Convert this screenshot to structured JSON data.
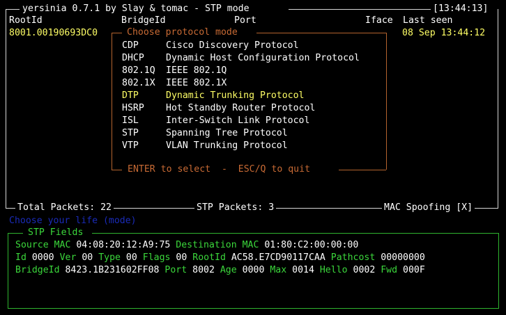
{
  "window": {
    "title": "yersinia 0.7.1 by Slay & tomac - STP mode",
    "clock": "[13:44:13]"
  },
  "table": {
    "headers": {
      "root_id": "RootId",
      "bridge_id": "BridgeId",
      "port": "Port",
      "iface": "Iface",
      "last_seen": "Last seen"
    },
    "rows": [
      {
        "root_id": "8001.00190693DC0",
        "last_seen": "08 Sep 13:44:12"
      }
    ]
  },
  "dialog": {
    "title": "Choose protocol mode",
    "items": [
      {
        "code": "CDP",
        "name": "Cisco Discovery Protocol"
      },
      {
        "code": "DHCP",
        "name": "Dynamic Host Configuration Protocol"
      },
      {
        "code": "802.1Q",
        "name": "IEEE 802.1Q"
      },
      {
        "code": "802.1X",
        "name": "IEEE 802.1X"
      },
      {
        "code": "DTP",
        "name": "Dynamic Trunking Protocol"
      },
      {
        "code": "HSRP",
        "name": "Hot Standby Router Protocol"
      },
      {
        "code": "ISL",
        "name": "Inter-Switch Link Protocol"
      },
      {
        "code": "STP",
        "name": "Spanning Tree Protocol"
      },
      {
        "code": "VTP",
        "name": "VLAN Trunking Protocol"
      }
    ],
    "selected_index": 4,
    "footer": "ENTER to select  -  ESC/Q to quit"
  },
  "status": {
    "total_packets": "Total Packets: 22",
    "stp_packets": "STP Packets: 3",
    "mac_spoofing": "MAC Spoofing [X]",
    "prompt": "Choose your life (mode)"
  },
  "stp_fields": {
    "title": "STP Fields",
    "source_mac_label": "Source MAC",
    "source_mac": "04:08:20:12:A9:75",
    "dest_mac_label": "Destination MAC",
    "dest_mac": "01:80:C2:00:00:00",
    "id_label": "Id",
    "id": "0000",
    "ver_label": "Ver",
    "ver": "00",
    "type_label": "Type",
    "type": "00",
    "flags_label": "Flags",
    "flags": "00",
    "rootid_label": "RootId",
    "rootid": "AC58.E7CD90117CAA",
    "pathcost_label": "Pathcost",
    "pathcost": "00000000",
    "bridgeid_label": "BridgeId",
    "bridgeid": "8423.1B231602FF08",
    "port_label": "Port",
    "port": "8002",
    "age_label": "Age",
    "age": "0000",
    "max_label": "Max",
    "max": "0014",
    "hello_label": "Hello",
    "hello": "0002",
    "fwd_label": "Fwd",
    "fwd": "000F"
  },
  "colors": {
    "background": "#000000",
    "text": "#ffffff",
    "highlight": "#ffff66",
    "dialog_border": "#c86a34",
    "fields": "#3bd73b",
    "prompt": "#1a2bb8"
  }
}
